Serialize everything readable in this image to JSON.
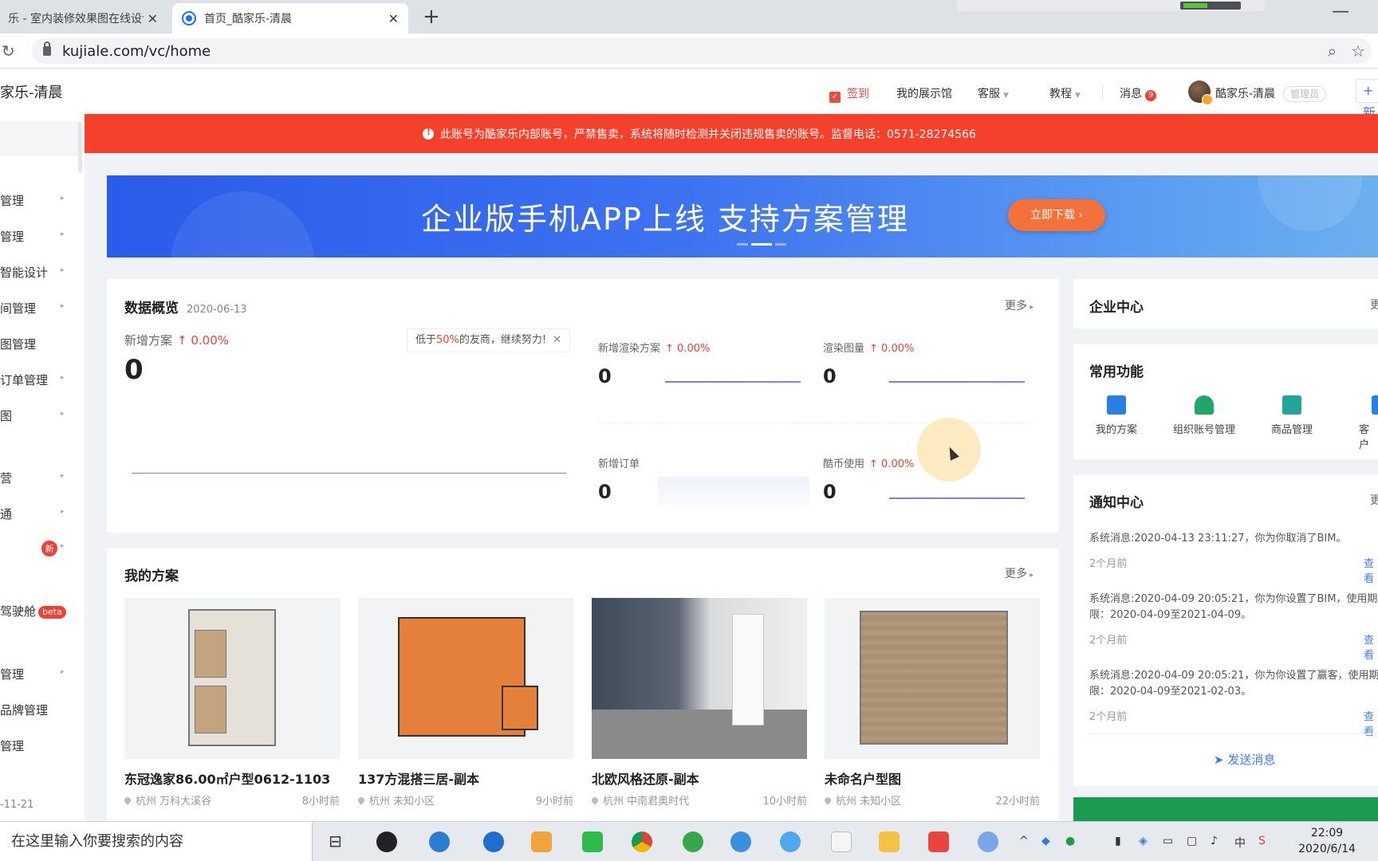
{
  "browser": {
    "tabs": [
      {
        "title": "乐 - 室内装修效果图在线设计"
      },
      {
        "title": "首页_酷家乐-清晨"
      }
    ],
    "url": "kujiale.com/vc/home",
    "new_tab": "+",
    "close": "✕"
  },
  "sidebar": {
    "brand": "家乐-清晨",
    "items": [
      {
        "label": "管理"
      },
      {
        "label": "管理"
      },
      {
        "label": "智能设计"
      },
      {
        "label": "间管理"
      },
      {
        "label": "图管理"
      },
      {
        "label": "订单管理"
      },
      {
        "label": "图"
      },
      {
        "label": "营"
      },
      {
        "label": "通"
      },
      {
        "label": ""
      },
      {
        "label": "驾驶舱"
      },
      {
        "label": "管理"
      },
      {
        "label": "品牌管理"
      },
      {
        "label": "管理"
      }
    ],
    "new_badge": "新",
    "beta_badge": "beta",
    "footer_date": "-11-21"
  },
  "header": {
    "checkin": "签到",
    "gallery": "我的展示馆",
    "service": "客服",
    "tutorial": "教程",
    "messages": "消息",
    "message_count": "9",
    "user": "酷家乐-清晨",
    "role": "管理员",
    "new_label": "+ 新"
  },
  "alert": {
    "text": "此账号为酷家乐内部账号，严禁售卖，系统将随时检测并关闭违规售卖的账号。监督电话：0571-28274566"
  },
  "banner": {
    "headline": "企业版手机APP上线 支持方案管理",
    "button": "立即下载 ›"
  },
  "overview": {
    "title": "数据概览",
    "date": "2020-06-13",
    "more": "更多",
    "new_plans": {
      "label": "新增方案",
      "change": "↑ 0.00%",
      "value": "0"
    },
    "tip": {
      "prefix": "低于",
      "percent": "50%",
      "suffix": "的友商，继续努力!",
      "close": "✕"
    },
    "render_plans": {
      "label": "新增渲染方案",
      "change": "↑ 0.00%",
      "value": "0"
    },
    "render_images": {
      "label": "渲染图量",
      "change": "↑ 0.00%",
      "value": "0"
    },
    "new_orders": {
      "label": "新增订单",
      "value": "0"
    },
    "coins": {
      "label": "酷币使用",
      "change": "↑ 0.00%",
      "value": "0"
    }
  },
  "plans": {
    "title": "我的方案",
    "more": "更多",
    "items": [
      {
        "name": "东冠逸家86.00㎡户型0612-1103",
        "location": "杭州 万科大溪谷",
        "time": "8小时前"
      },
      {
        "name": "137方混搭三居-副本",
        "location": "杭州 未知小区",
        "time": "9小时前"
      },
      {
        "name": "北欧风格还原-副本",
        "location": "杭州 中南君奥时代",
        "time": "10小时前"
      },
      {
        "name": "未命名户型图",
        "location": "杭州 未知小区",
        "time": "22小时前"
      }
    ]
  },
  "enterprise": {
    "title": "企业中心",
    "more": "更"
  },
  "functions": {
    "title": "常用功能",
    "items": [
      {
        "label": "我的方案",
        "icon": "folder-icon",
        "color": "#2a7de1"
      },
      {
        "label": "组织账号管理",
        "icon": "user-icon",
        "color": "#1fa76a"
      },
      {
        "label": "商品管理",
        "icon": "shop-bag-icon",
        "color": "#23a59b"
      },
      {
        "label": "客户",
        "icon": "customer-icon",
        "color": "#2a7de1"
      }
    ]
  },
  "notices": {
    "title": "通知中心",
    "more": "更",
    "items": [
      {
        "text": "系统消息:2020-04-13 23:11:27，你为你取消了BIM。",
        "time": "2个月前",
        "view": "查看"
      },
      {
        "text": "系统消息:2020-04-09 20:05:21，你为你设置了BIM，使用期限：2020-04-09至2021-04-09。",
        "time": "2个月前",
        "view": "查看"
      },
      {
        "text": "系统消息:2020-04-09 20:05:21，你为你设置了赢客，使用期限：2020-04-09至2021-02-03。",
        "time": "2个月前",
        "view": "查看"
      }
    ],
    "send": "发送消息"
  },
  "taskbar": {
    "search_placeholder": "在这里输入你要搜索的内容",
    "time": "22:09",
    "date": "2020/6/14",
    "ime": "中"
  },
  "colors": {
    "accent": "#3d7cf2",
    "alert": "#f5402c",
    "up": "#f04134"
  }
}
